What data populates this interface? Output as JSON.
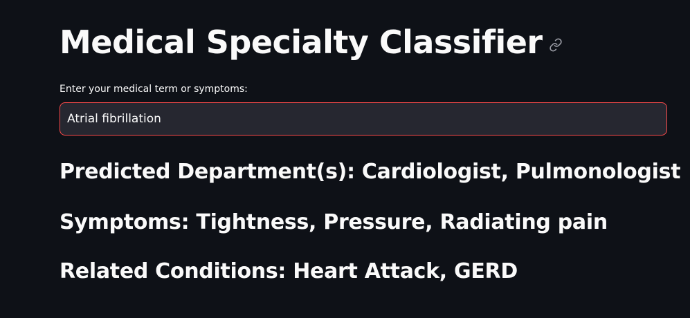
{
  "app": {
    "title": "Medical Specialty Classifier",
    "link_icon": "link-icon"
  },
  "form": {
    "label": "Enter your medical term or symptoms:",
    "input_value": "Atrial fibrillation"
  },
  "results": {
    "departments": "Predicted Department(s): Cardiologist, Pulmonologist",
    "symptoms": "Symptoms: Tightness, Pressure, Radiating pain",
    "conditions": "Related Conditions: Heart Attack, GERD"
  },
  "colors": {
    "background": "#0e1117",
    "text": "#fafafa",
    "input_background": "#262730",
    "input_border_focus": "#ff4b4b",
    "icon": "#9a9ca5"
  }
}
